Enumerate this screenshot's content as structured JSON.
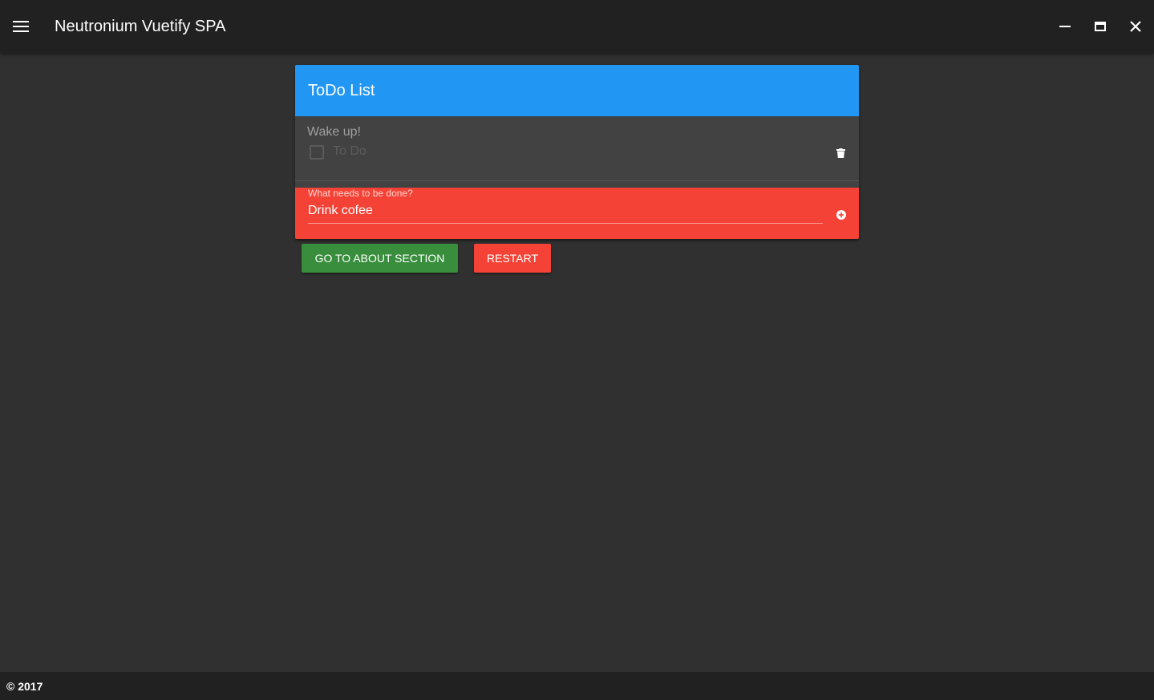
{
  "toolbar": {
    "title": "Neutronium Vuetify SPA",
    "menu_icon": "menu-icon",
    "window_controls": [
      "minimize-icon",
      "maximize-icon",
      "close-icon"
    ]
  },
  "card": {
    "title": "ToDo List",
    "items": [
      {
        "description": "Wake up!",
        "status_label": "To Do",
        "done": false,
        "delete_icon": "trash-icon"
      }
    ],
    "new_todo": {
      "label": "What needs to be done?",
      "value": "Drink cofee",
      "add_icon": "plus-circle-icon"
    }
  },
  "actions": {
    "about_label": "Go to about section",
    "restart_label": "Restart"
  },
  "footer": {
    "text": "© 2017"
  },
  "colors": {
    "background": "#303030",
    "toolbar": "#212121",
    "card_header": "#2196f3",
    "card_body": "#424242",
    "new_todo": "#f44336",
    "about_button": "#388e3c",
    "restart_button": "#f44336"
  }
}
